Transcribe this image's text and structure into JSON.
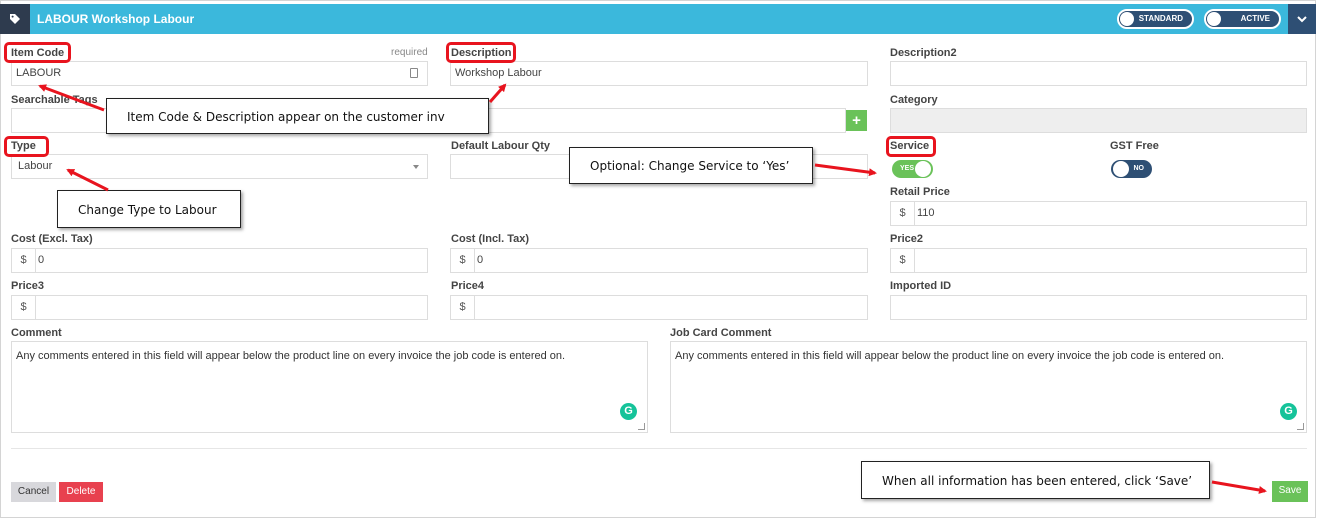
{
  "header": {
    "title": "LABOUR Workshop Labour",
    "tag_icon": "tag-icon",
    "toggle_standard": "STANDARD",
    "toggle_active": "ACTIVE",
    "menu_icon": "chevron-down-icon",
    "bar_color": "#3bb8dc",
    "dark_color": "#2e4f74"
  },
  "form": {
    "item_code": {
      "label": "Item Code",
      "required": "required",
      "value": "LABOUR"
    },
    "description": {
      "label": "Description",
      "value": "Workshop Labour"
    },
    "description2": {
      "label": "Description2",
      "value": ""
    },
    "searchable_tags": {
      "label": "Searchable Tags",
      "value": ""
    },
    "category": {
      "label": "Category",
      "value": ""
    },
    "type": {
      "label": "Type",
      "value": "Labour"
    },
    "default_labour_qty": {
      "label": "Default Labour Qty",
      "value": ""
    },
    "service": {
      "label": "Service",
      "state": "YES"
    },
    "gst_free": {
      "label": "GST Free",
      "state": "NO"
    },
    "retail_price": {
      "label": "Retail Price",
      "prefix": "$",
      "value": "110"
    },
    "cost_excl": {
      "label": "Cost (Excl. Tax)",
      "prefix": "$",
      "value": "0"
    },
    "cost_incl": {
      "label": "Cost (Incl. Tax)",
      "prefix": "$",
      "value": "0"
    },
    "price2": {
      "label": "Price2",
      "prefix": "$",
      "value": ""
    },
    "price3": {
      "label": "Price3",
      "prefix": "$",
      "value": ""
    },
    "price4": {
      "label": "Price4",
      "prefix": "$",
      "value": ""
    },
    "imported_id": {
      "label": "Imported ID",
      "value": ""
    },
    "comment": {
      "label": "Comment",
      "value": "Any comments entered in this field will appear below the product line on every invoice the job code is entered on."
    },
    "job_card_comment": {
      "label": "Job Card Comment",
      "value": "Any comments entered in this field will appear below the product line on every invoice the job code is entered on."
    }
  },
  "actions": {
    "cancel": "Cancel",
    "delete": "Delete",
    "save": "Save"
  },
  "annotations": {
    "item_code_desc": "Item Code & Description appear on the customer inv",
    "type": "Change Type to Labour",
    "service": "Optional: Change Service to ‘Yes’",
    "save": "When all information has been entered, click ‘Save’",
    "color": "#e8141e"
  }
}
